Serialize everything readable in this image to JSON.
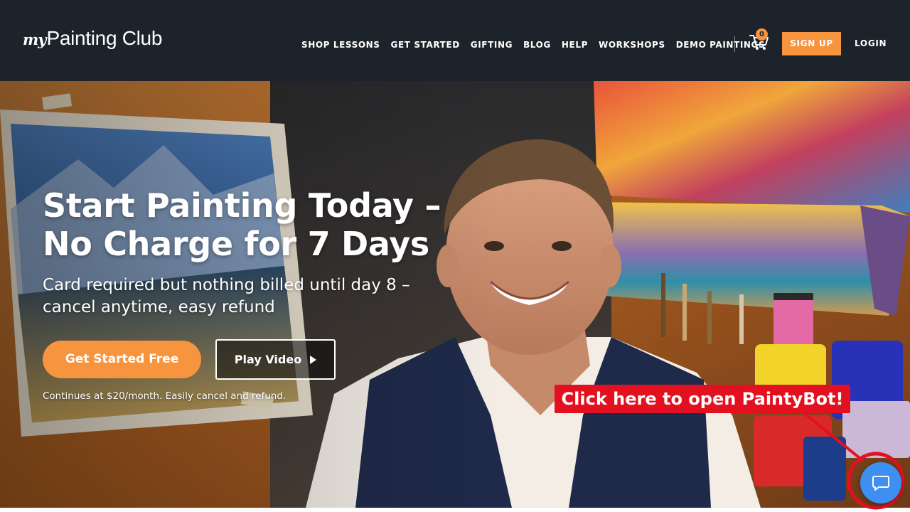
{
  "header": {
    "logo": {
      "prefix": "my",
      "name": "Painting Club"
    },
    "nav": [
      {
        "id": "shop-lessons",
        "label": "SHOP LESSONS"
      },
      {
        "id": "get-started",
        "label": "GET STARTED"
      },
      {
        "id": "gifting",
        "label": "GIFTING"
      },
      {
        "id": "blog",
        "label": "BLOG"
      },
      {
        "id": "help",
        "label": "HELP"
      },
      {
        "id": "workshops",
        "label": "WORKSHOPS"
      },
      {
        "id": "demo-paintings",
        "label": "DEMO PAINTINGS"
      }
    ],
    "cart": {
      "icon": "cart-icon",
      "count": "0"
    },
    "signup_label": "SIGN UP",
    "login_label": "LOGIN"
  },
  "hero": {
    "title_line1": "Start Painting Today –",
    "title_line2": "No Charge for 7 Days",
    "subtitle_line1": "Card required but nothing billed until day 8 –",
    "subtitle_line2": "cancel anytime, easy refund",
    "primary_cta": "Get Started Free",
    "secondary_cta": "Play Video",
    "secondary_icon": "play-icon",
    "note": "Continues at $20/month. Easily cancel and refund."
  },
  "annotation": {
    "label": "Click here to open PaintyBot!",
    "color": "#e3101f"
  },
  "chat": {
    "icon": "chat-bubble-icon"
  },
  "colors": {
    "header_bg": "#1d232b",
    "accent_orange": "#f7943e",
    "chat_blue": "#3d8ff2",
    "annotation_red": "#e3101f"
  }
}
